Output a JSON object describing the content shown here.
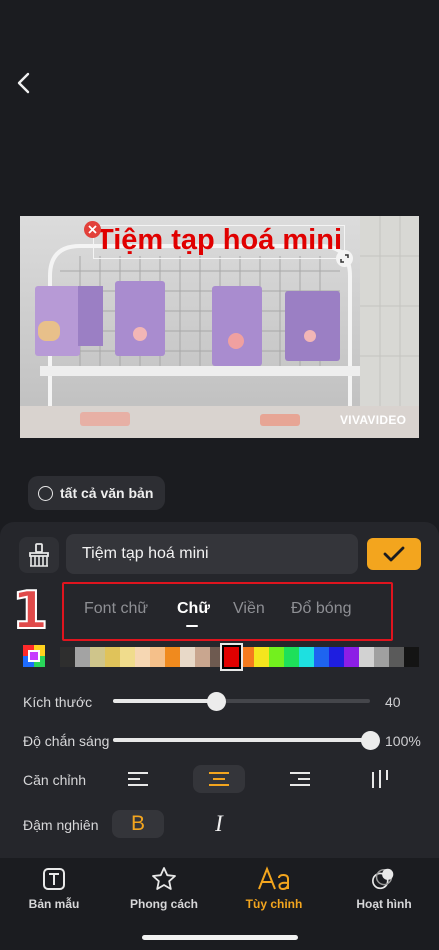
{
  "preview": {
    "overlay_text": "Tiệm tạp hoá mini",
    "watermark": "VIVAVIDEO"
  },
  "all_text_toggle": {
    "label": "tất cả văn bản",
    "checked": false
  },
  "editor": {
    "text_value": "Tiệm tạp hoá mini",
    "confirm_icon": "check-icon",
    "clear_icon": "eraser-icon"
  },
  "annotation": {
    "step_number": "1"
  },
  "tabs": [
    {
      "label": "Font chữ",
      "active": false
    },
    {
      "label": "Chữ",
      "active": true
    },
    {
      "label": "Viền",
      "active": false
    },
    {
      "label": "Đổ bóng",
      "active": false
    }
  ],
  "colors": {
    "accent": "#f3a51e",
    "highlight_box": "#e0141e",
    "selected_swatch": "#e00000",
    "swatches": [
      "#2e2e2e",
      "#a3a3a3",
      "#cfc58b",
      "#e0c35a",
      "#f0dc8c",
      "#f6d7b3",
      "#f5c08a",
      "#f08a1e",
      "#e8d9c8",
      "#c9a68f",
      "#6e5a50",
      "#e00000",
      "#f57a1e",
      "#f5e51e",
      "#73f01e",
      "#1ee05a",
      "#1ee0e0",
      "#1e64f0",
      "#1e1ee0",
      "#8c1ee6",
      "#d2d2d2",
      "#a0a0a0",
      "#5a5a5a",
      "#141414"
    ]
  },
  "size": {
    "label": "Kích thước",
    "value": "40",
    "fraction": 0.4
  },
  "opacity": {
    "label": "Độ chắn sáng",
    "value": "100%",
    "fraction": 1.0
  },
  "alignment": {
    "label": "Căn chỉnh",
    "options": [
      "align-left-icon",
      "align-center-icon",
      "align-right-icon",
      "align-vertical-icon"
    ],
    "selected": "align-center-icon"
  },
  "style": {
    "label": "Đậm nghiên",
    "bold_label": "B",
    "italic_label": "I",
    "bold_active": true
  },
  "bottom_nav": [
    {
      "label": "Bản mẫu",
      "icon": "text-template-icon",
      "active": false
    },
    {
      "label": "Phong cách",
      "icon": "star-icon",
      "active": false
    },
    {
      "label": "Tùy chỉnh",
      "icon": "font-aa-icon",
      "active": true
    },
    {
      "label": "Hoạt hình",
      "icon": "animation-icon",
      "active": false
    }
  ]
}
